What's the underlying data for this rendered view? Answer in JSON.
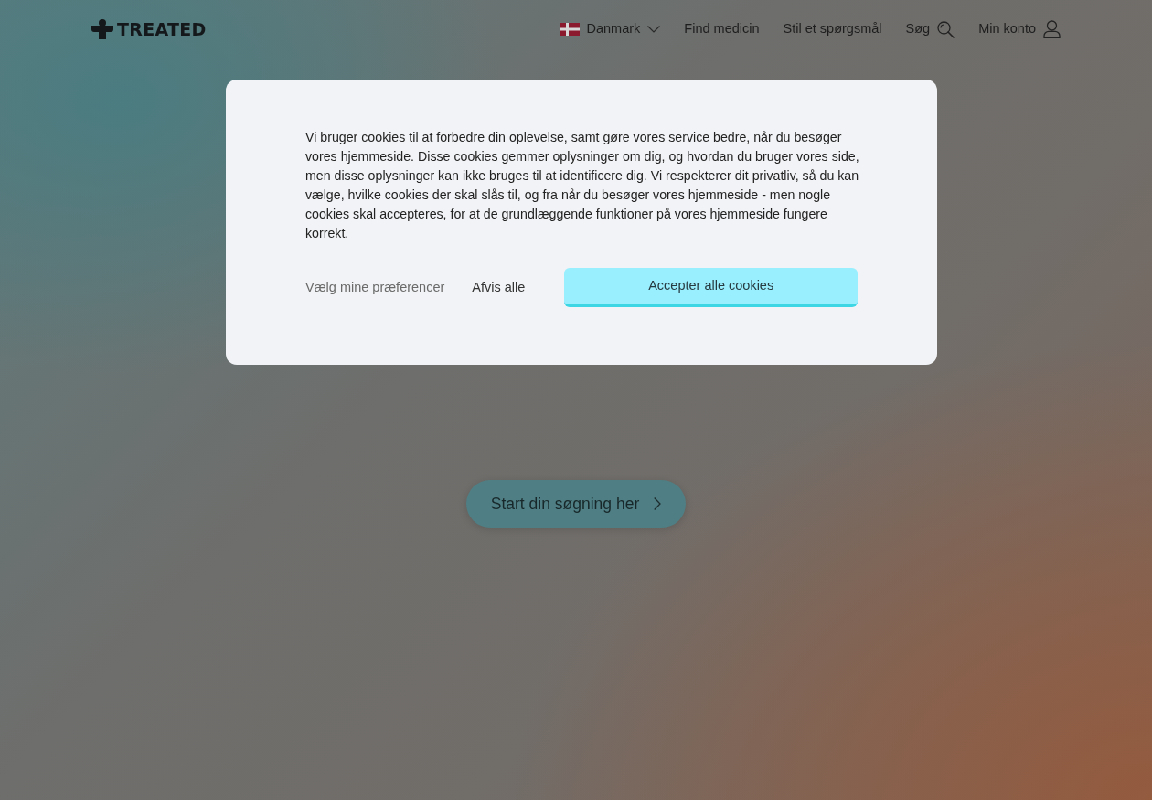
{
  "header": {
    "logo": "TREATED",
    "country": {
      "label": "Danmark"
    },
    "nav": [
      "Find medicin",
      "Stil et spørgsmål"
    ],
    "search": "Søg",
    "account": "Min konto"
  },
  "hero": {
    "search_button": "Start din søgning her"
  },
  "cookie_dialog": {
    "text": "Vi bruger cookies til at forbedre din oplevelse, samt gøre vores service bedre, når du besøger vores hjemmeside. Disse cookies gemmer oplysninger om dig, og hvordan du bruger vores side, men disse oplysninger kan ikke bruges til at identificere dig. Vi respekterer dit privatliv, så du kan vælge, hvilke cookies der skal slås til, og fra når du besøger vores hjemmeside - men nogle cookies skal accepteres, for at de grundlæggende funktioner på vores hjemmeside fungere korrekt.",
    "preferences_link": "Vælg mine præferencer",
    "reject_link": "Afvis alle",
    "accept_button": "Accepter alle cookies"
  }
}
